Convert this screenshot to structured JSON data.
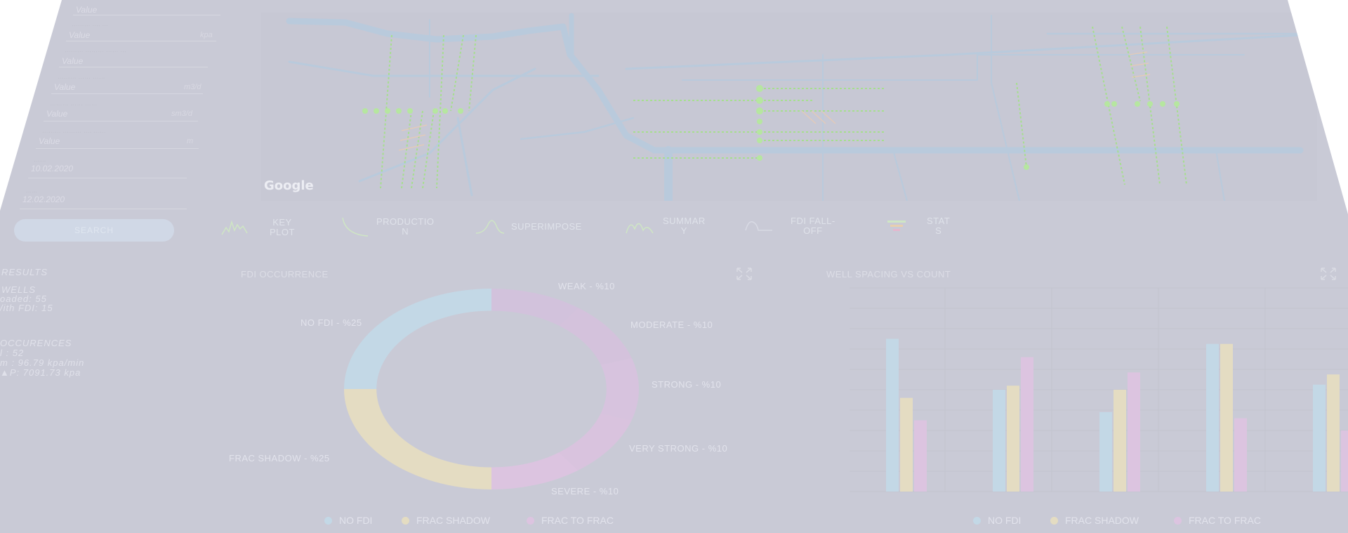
{
  "colors": {
    "background": "#c9cad6",
    "no_fdi": "#c3d8e6",
    "frac_shadow": "#e4dcc2",
    "frac_to_frac": "#dcc4e0",
    "well_line": "#a6df8e",
    "road": "#b7c9dd",
    "accent_button": "#d0d8e6"
  },
  "filters": {
    "fields": [
      {
        "value": "Value",
        "unit": ""
      },
      {
        "value": "Value",
        "unit": "kpa",
        "hint": "……… …. …"
      },
      {
        "value": "Value",
        "unit": "",
        "hint": "……… ……… …… …"
      },
      {
        "value": "Value",
        "unit": "m3/d",
        "hint": "……… …… ……"
      },
      {
        "value": "Value",
        "unit": "sm3/d",
        "hint": "……… …… ……"
      },
      {
        "value": "Value",
        "unit": "m",
        "hint": "……… ……… …. ……"
      },
      {
        "value": "10.02.2020",
        "unit": "",
        "hint": "……"
      },
      {
        "value": "12.02.2020",
        "unit": "",
        "hint": "……"
      }
    ],
    "search_label": "SEARCH"
  },
  "map": {
    "logo": "Google"
  },
  "tabs": [
    {
      "label_1": "KEY",
      "label_2": "PLOT",
      "icon": "key-plot-icon"
    },
    {
      "label_1": "PRODUCTIO",
      "label_2": "N",
      "icon": "production-icon"
    },
    {
      "label_1": "SUPERIMPOSE",
      "label_2": "",
      "icon": "superimpose-icon"
    },
    {
      "label_1": "SUMMAR",
      "label_2": "Y",
      "icon": "summary-icon"
    },
    {
      "label_1": "FDI FALL-",
      "label_2": "OFF",
      "icon": "fdi-falloff-icon"
    },
    {
      "label_1": "STAT",
      "label_2": "S",
      "icon": "stats-icon"
    }
  ],
  "results": {
    "heading": "RESULTS",
    "wells_heading": "WELLS",
    "wells_loaded": "oaded: 55",
    "wells_fdi": "/ith FDI: 15",
    "occ_heading": "OCCURENCES",
    "occ_total": "l     :      52",
    "occ_rate": "m    :      96.79 kpa/min",
    "occ_dp": "▲P:      7091.73 kpa"
  },
  "chart_data": [
    {
      "type": "pie",
      "title": "FDI OCCURRENCE",
      "slices": [
        {
          "label": "NO FDI - %25",
          "value": 25,
          "group": "NO FDI"
        },
        {
          "label": "WEAK - %10",
          "value": 10,
          "group": "FRAC TO FRAC"
        },
        {
          "label": "MODERATE - %10",
          "value": 10,
          "group": "FRAC TO FRAC"
        },
        {
          "label": "STRONG - %10",
          "value": 10,
          "group": "FRAC TO FRAC"
        },
        {
          "label": "VERY STRONG - %10",
          "value": 10,
          "group": "FRAC TO FRAC"
        },
        {
          "label": "SEVERE - %10",
          "value": 10,
          "group": "FRAC TO FRAC"
        },
        {
          "label": "FRAC SHADOW - %25",
          "value": 25,
          "group": "FRAC SHADOW"
        }
      ],
      "legend": [
        "NO FDI",
        "FRAC SHADOW",
        "FRAC TO FRAC"
      ],
      "legend_position": "bottom"
    },
    {
      "type": "bar",
      "title": "WELL SPACING VS COUNT",
      "categories": [
        "",
        "",
        "",
        "",
        ""
      ],
      "series": [
        {
          "name": "NO FDI",
          "values": [
            1500,
            1000,
            780,
            1450,
            1050
          ]
        },
        {
          "name": "FRAC SHADOW",
          "values": [
            920,
            1040,
            1000,
            1450,
            1150
          ]
        },
        {
          "name": "FRAC TO FRAC",
          "values": [
            700,
            1320,
            1170,
            720,
            600
          ]
        }
      ],
      "ylim": [
        0,
        2000
      ],
      "grid": true,
      "legend": [
        "NO FDI",
        "FRAC SHADOW",
        "FRAC TO FRAC"
      ],
      "legend_position": "bottom"
    }
  ]
}
